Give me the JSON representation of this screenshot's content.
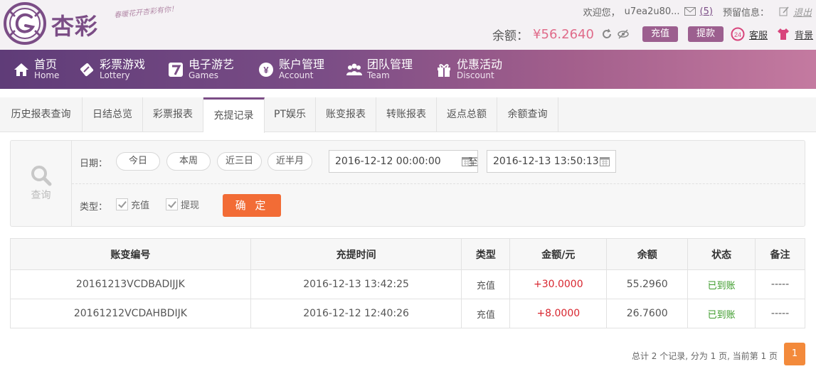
{
  "header": {
    "brand": "杏彩",
    "slogan": "春暖花开杏彩有你！",
    "welcome": "欢迎您，",
    "username": "u7ea2u80...",
    "mail_count": "(5)",
    "reserve_info_label": "预留信息：",
    "logout": "退出",
    "balance_label": "余额：",
    "balance_value": "¥56.2640",
    "recharge_button": "充值",
    "withdraw_button": "提款",
    "service_link": "客服",
    "background_link": "背景",
    "accent_color": "#7b4d86"
  },
  "nav": [
    {
      "cn": "首页",
      "en": "Home",
      "icon": "home-icon"
    },
    {
      "cn": "彩票游戏",
      "en": "Lottery",
      "icon": "lottery-icon"
    },
    {
      "cn": "电子游艺",
      "en": "Games",
      "icon": "games-icon"
    },
    {
      "cn": "账户管理",
      "en": "Account",
      "icon": "account-icon"
    },
    {
      "cn": "团队管理",
      "en": "Team",
      "icon": "team-icon"
    },
    {
      "cn": "优惠活动",
      "en": "Discount",
      "icon": "gift-icon"
    }
  ],
  "tabs": [
    "历史报表查询",
    "日结总览",
    "彩票报表",
    "充提记录",
    "PT娱乐",
    "账变报表",
    "转账报表",
    "返点总额",
    "余额查询"
  ],
  "active_tab": "充提记录",
  "query": {
    "side_label": "查询",
    "date_label": "日期：",
    "quick_dates": [
      "今日",
      "本周",
      "近三日",
      "近半月"
    ],
    "start_date": "2016-12-12 00:00:00",
    "to_label": "至",
    "end_date": "2016-12-13 13:50:13",
    "type_label": "类型：",
    "types": [
      "充值",
      "提现"
    ],
    "confirm": "确 定"
  },
  "table": {
    "headers": [
      "账变编号",
      "充提时间",
      "类型",
      "金额/元",
      "余额",
      "状态",
      "备注"
    ],
    "rows": [
      [
        "20161213VCDBADIJJK",
        "2016-12-13 13:42:25",
        "充值",
        "+30.0000",
        "55.2960",
        "已到账",
        "-----"
      ],
      [
        "20161212VCDAHBDIJK",
        "2016-12-12 12:40:26",
        "充值",
        "+8.0000",
        "26.7600",
        "已到账",
        "-----"
      ]
    ]
  },
  "pager": {
    "info": "总计 2 个记录, 分为 1 页, 当前第 1 页",
    "current": "1"
  }
}
